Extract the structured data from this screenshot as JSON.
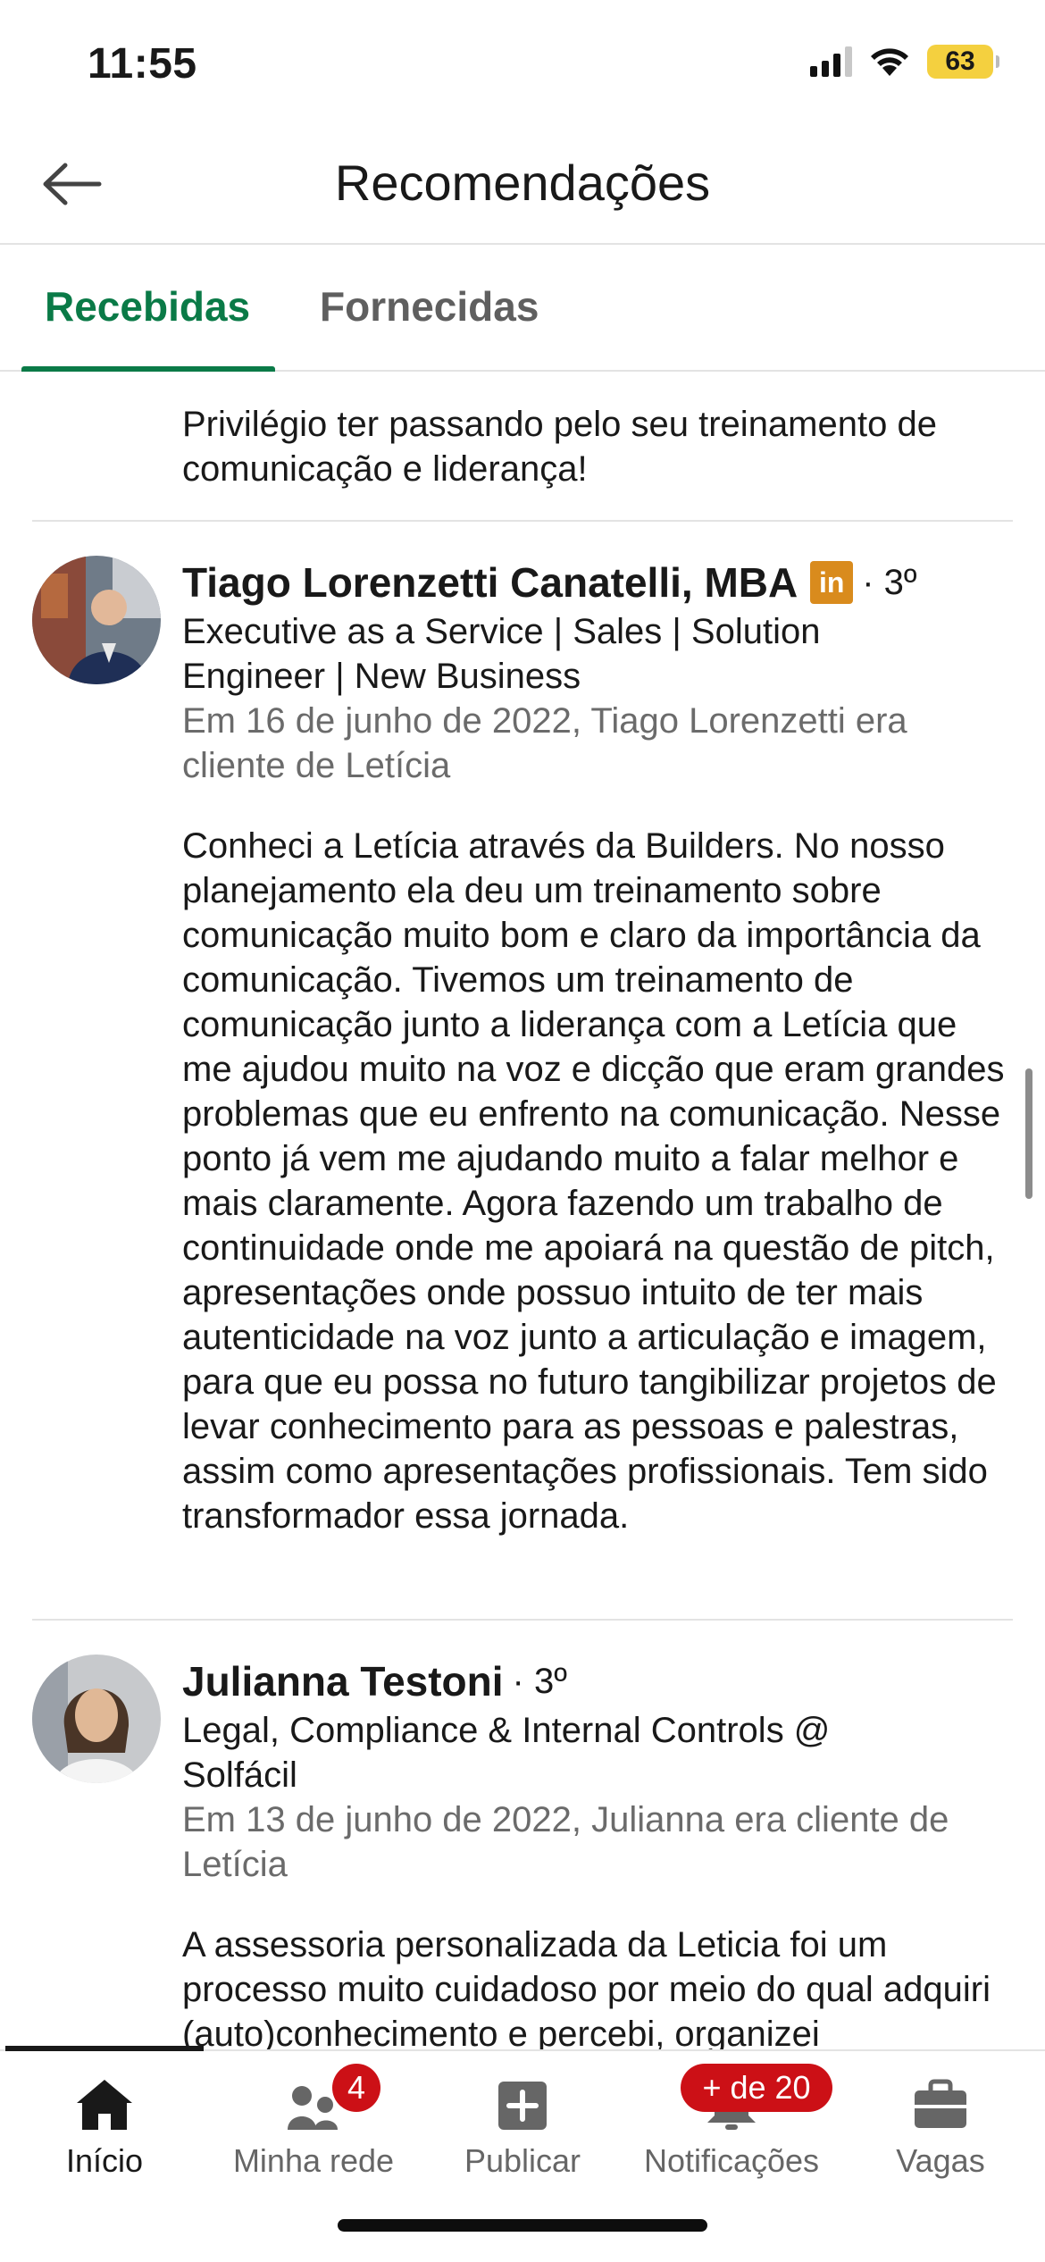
{
  "status_bar": {
    "time": "11:55",
    "battery": "63"
  },
  "header": {
    "title": "Recomendações"
  },
  "tabs": [
    {
      "label": "Recebidas",
      "active": true
    },
    {
      "label": "Fornecidas",
      "active": false
    }
  ],
  "previous_rec": {
    "text": "Privilégio ter passando pelo seu treinamento de comunicação e liderança!"
  },
  "recommendations": [
    {
      "name": "Tiago Lorenzetti Canatelli, MBA",
      "linkedin_badge": "in",
      "degree": "· 3º",
      "headline": "Executive as a Service | Sales | Solution Engineer | New Business",
      "meta": "Em 16 de junho de 2022, Tiago Lorenzetti era cliente de Letícia",
      "text": "Conheci a Letícia através da Builders. No nosso planejamento ela deu um treinamento sobre comunicação muito bom e claro da importância da comunicação. Tivemos um treinamento de comunicação junto a liderança com a Letícia que me ajudou muito na voz e dicção que eram grandes problemas que eu enfrento na comunicação. Nesse ponto já vem me ajudando muito a falar melhor e mais claramente. Agora fazendo um trabalho de continuidade onde me apoiará na questão de pitch, apresentações onde possuo intuito de ter mais autenticidade na voz junto a articulação e imagem, para que eu possa no futuro tangibilizar projetos de levar conhecimento para as pessoas e palestras, assim como apresentações profissionais. Tem sido transformador essa jornada."
    },
    {
      "name": "Julianna Testoni",
      "degree": "· 3º",
      "headline": "Legal, Compliance & Internal Controls @ Solfácil",
      "meta": "Em 13 de junho de 2022, Julianna era cliente de Letícia",
      "text": "A assessoria personalizada da Leticia foi um processo muito cuidadoso por meio do qual adquiri (auto)conhecimento e percebi, organizei"
    }
  ],
  "bottom_nav": [
    {
      "label": "Início",
      "icon": "home-icon",
      "active": true
    },
    {
      "label": "Minha rede",
      "icon": "network-icon",
      "badge": "4"
    },
    {
      "label": "Publicar",
      "icon": "post-icon"
    },
    {
      "label": "Notificações",
      "icon": "bell-icon",
      "badge": "+ de 20"
    },
    {
      "label": "Vagas",
      "icon": "briefcase-icon"
    }
  ],
  "colors": {
    "accent": "#0a7a47",
    "badge": "#cc1016",
    "linkedin_badge": "#d98b1d"
  }
}
